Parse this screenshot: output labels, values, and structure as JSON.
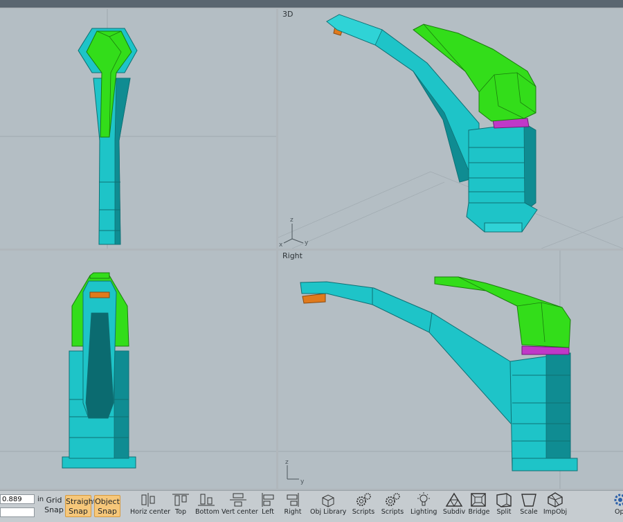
{
  "viewports": {
    "top": {
      "label": ""
    },
    "perspective": {
      "label": "3D",
      "axis_labels": {
        "x": "x",
        "y": "y",
        "z": "z"
      }
    },
    "front": {
      "label": ""
    },
    "right": {
      "label": "Right",
      "axis_labels": {
        "y": "y",
        "z": "z"
      }
    }
  },
  "colors": {
    "viewport_bg": "#b4bec4",
    "spout_teal": "#1ec4c8",
    "spout_teal_dark": "#0f8c92",
    "handle_green": "#33dd1a",
    "handle_green_dark": "#1f9c10",
    "aerator_orange": "#e07a1c",
    "ring_magenta": "#c038c8",
    "snap_active": "#f6c77a"
  },
  "toolbar": {
    "value": "0.889",
    "unit": "in",
    "grid_snap": "Grid Snap",
    "straight_snap": "Straight Snap",
    "object_snap": "Object Snap",
    "tools": [
      {
        "label": "Horiz center",
        "icon": "horiz-center-icon"
      },
      {
        "label": "Top",
        "icon": "align-top-icon"
      },
      {
        "label": "Bottom",
        "icon": "align-bottom-icon"
      },
      {
        "label": "Vert center",
        "icon": "vert-center-icon"
      },
      {
        "label": "Left",
        "icon": "align-left-icon"
      },
      {
        "label": "Right",
        "icon": "align-right-icon"
      },
      {
        "label": "Obj Library",
        "icon": "obj-library-icon"
      },
      {
        "label": "Scripts",
        "icon": "scripts-gear-icon"
      },
      {
        "label": "Scripts",
        "icon": "scripts-gear-icon"
      },
      {
        "label": "Lighting",
        "icon": "lightbulb-icon"
      },
      {
        "label": "Subdiv",
        "icon": "subdiv-icon"
      },
      {
        "label": "Bridge",
        "icon": "bridge-icon"
      },
      {
        "label": "Split",
        "icon": "split-icon"
      },
      {
        "label": "Scale",
        "icon": "scale-icon"
      },
      {
        "label": "ImpObj",
        "icon": "import-obj-icon"
      },
      {
        "label": "Opt",
        "icon": "options-gear-icon"
      }
    ]
  }
}
